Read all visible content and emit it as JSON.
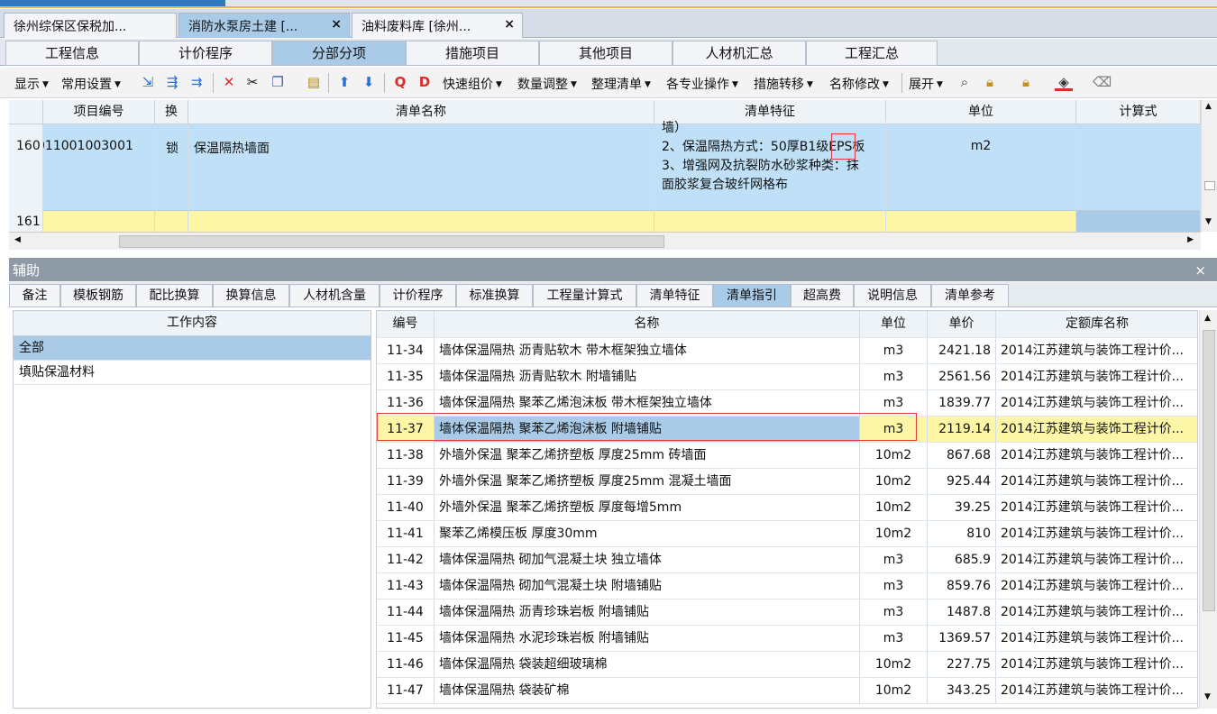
{
  "doc_tabs": [
    {
      "label": "徐州综保区保税加..."
    },
    {
      "label": "消防水泵房土建 [..."
    },
    {
      "label": "油料废料库 [徐州..."
    }
  ],
  "close_glyph": "×",
  "main_tabs": [
    "工程信息",
    "计价程序",
    "分部分项",
    "措施项目",
    "其他项目",
    "人材机汇总",
    "工程汇总"
  ],
  "toolbar": {
    "display": "显示",
    "common_settings": "常用设置",
    "quick_price": "快速组价",
    "qty_adjust": "数量调整",
    "organize": "整理清单",
    "specialty_ops": "各专业操作",
    "measure_transfer": "措施转移",
    "rename": "名称修改",
    "expand": "展开"
  },
  "grid1": {
    "headers": [
      "项目编号",
      "换",
      "清单名称",
      "清单特征",
      "单位",
      "计算式"
    ],
    "row160": {
      "num": "160",
      "code": "011001003001",
      "swap": "锁",
      "name": "保温隔热墙面",
      "feature_lines": [
        "墙）",
        "2、保温隔热方式：50厚B1级EPS板",
        "3、增强网及抗裂防水砂浆种类：抹",
        "面胶浆复合玻纤网格布"
      ],
      "unit": "m2"
    },
    "row161": {
      "num": "161"
    }
  },
  "aux": {
    "title": "辅助",
    "title_controls": "ᅟ ×",
    "tabs": [
      "备注",
      "模板钢筋",
      "配比换算",
      "换算信息",
      "人材机含量",
      "计价程序",
      "标准换算",
      "工程量计算式",
      "清单特征",
      "清单指引",
      "超高费",
      "说明信息",
      "清单参考"
    ]
  },
  "left_panel": {
    "header": "工作内容",
    "items": [
      "全部",
      "填贴保温材料"
    ]
  },
  "right_panel": {
    "headers": [
      "编号",
      "名称",
      "单位",
      "单价",
      "定额库名称"
    ],
    "rows": [
      {
        "code": "11-34",
        "name": "墙体保温隔热 沥青贴软木 带木框架独立墙体",
        "unit": "m3",
        "price": "2421.18",
        "lib": "2014江苏建筑与装饰工程计价..."
      },
      {
        "code": "11-35",
        "name": "墙体保温隔热 沥青贴软木 附墙铺贴",
        "unit": "m3",
        "price": "2561.56",
        "lib": "2014江苏建筑与装饰工程计价..."
      },
      {
        "code": "11-36",
        "name": "墙体保温隔热 聚苯乙烯泡沫板 带木框架独立墙体",
        "unit": "m3",
        "price": "1839.77",
        "lib": "2014江苏建筑与装饰工程计价..."
      },
      {
        "code": "11-37",
        "name": "墙体保温隔热 聚苯乙烯泡沫板 附墙铺贴",
        "unit": "m3",
        "price": "2119.14",
        "lib": "2014江苏建筑与装饰工程计价..."
      },
      {
        "code": "11-38",
        "name": "外墙外保温  聚苯乙烯挤塑板 厚度25mm 砖墙面",
        "unit": "10m2",
        "price": "867.68",
        "lib": "2014江苏建筑与装饰工程计价..."
      },
      {
        "code": "11-39",
        "name": "外墙外保温  聚苯乙烯挤塑板 厚度25mm 混凝土墙面",
        "unit": "10m2",
        "price": "925.44",
        "lib": "2014江苏建筑与装饰工程计价..."
      },
      {
        "code": "11-40",
        "name": "外墙外保温  聚苯乙烯挤塑板 厚度每增5mm",
        "unit": "10m2",
        "price": "39.25",
        "lib": "2014江苏建筑与装饰工程计价..."
      },
      {
        "code": "11-41",
        "name": "聚苯乙烯模压板 厚度30mm",
        "unit": "10m2",
        "price": "810",
        "lib": "2014江苏建筑与装饰工程计价..."
      },
      {
        "code": "11-42",
        "name": "墙体保温隔热 砌加气混凝土块 独立墙体",
        "unit": "m3",
        "price": "685.9",
        "lib": "2014江苏建筑与装饰工程计价..."
      },
      {
        "code": "11-43",
        "name": "墙体保温隔热 砌加气混凝土块 附墙铺贴",
        "unit": "m3",
        "price": "859.76",
        "lib": "2014江苏建筑与装饰工程计价..."
      },
      {
        "code": "11-44",
        "name": "墙体保温隔热 沥青珍珠岩板 附墙铺贴",
        "unit": "m3",
        "price": "1487.8",
        "lib": "2014江苏建筑与装饰工程计价..."
      },
      {
        "code": "11-45",
        "name": "墙体保温隔热 水泥珍珠岩板 附墙铺贴",
        "unit": "m3",
        "price": "1369.57",
        "lib": "2014江苏建筑与装饰工程计价..."
      },
      {
        "code": "11-46",
        "name": "墙体保温隔热 袋装超细玻璃棉",
        "unit": "10m2",
        "price": "227.75",
        "lib": "2014江苏建筑与装饰工程计价..."
      },
      {
        "code": "11-47",
        "name": "墙体保温隔热 袋装矿棉",
        "unit": "10m2",
        "price": "343.25",
        "lib": "2014江苏建筑与装饰工程计价..."
      }
    ]
  },
  "colors": {
    "selected_blue": "#a9cbe8",
    "highlight_yellow": "#fdf6a6",
    "red_outline": "#e23b3b"
  }
}
